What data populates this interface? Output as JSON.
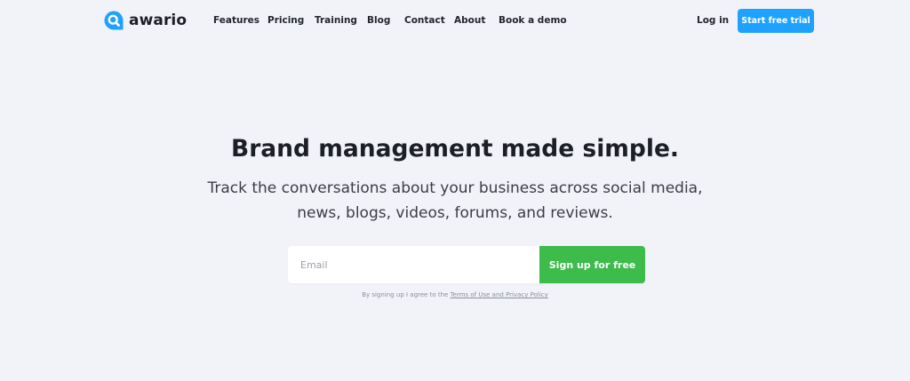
{
  "brand": {
    "name": "awario",
    "logo_icon": "awario-chat-magnifier-icon",
    "logo_color": "#1fa2ff"
  },
  "nav": {
    "items": [
      {
        "label": "Features"
      },
      {
        "label": "Pricing"
      },
      {
        "label": "Training"
      },
      {
        "label": "Blog"
      },
      {
        "label": "Contact"
      },
      {
        "label": "About"
      },
      {
        "label": "Book a demo"
      }
    ],
    "login_label": "Log in",
    "cta_label": "Start free trial",
    "cta_color": "#1fa2ff"
  },
  "hero": {
    "title": "Brand management made simple.",
    "subtitle_line1": "Track the conversations about your business across social media,",
    "subtitle_line2": "news, blogs, videos, forums, and reviews."
  },
  "signup": {
    "email_placeholder": "Email",
    "button_label": "Sign up for free",
    "button_color": "#3dbb4b",
    "terms_prefix": "By signing up I agree to the ",
    "terms_link": "Terms of Use and Privacy Policy"
  },
  "colors": {
    "background": "#f2f3f8"
  }
}
